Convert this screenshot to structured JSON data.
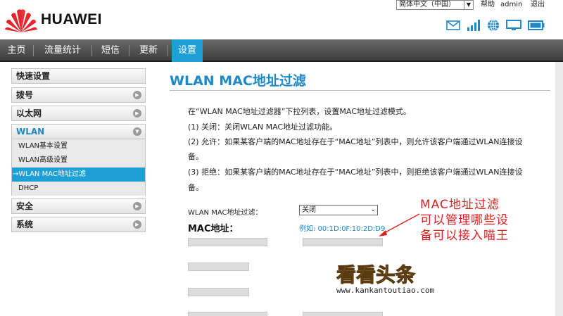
{
  "brand": {
    "name": "HUAWEI",
    "logo_color": "#e5262c"
  },
  "header": {
    "language": "简体中文（中国）",
    "help": "帮助",
    "user": "admin",
    "logout": "退出",
    "status_icons": [
      "mail-icon",
      "signal-icon",
      "globe-icon",
      "monitor-icon",
      "battery-icon"
    ]
  },
  "nav": {
    "items": [
      "主页",
      "流量统计",
      "短信",
      "更新",
      "设置"
    ],
    "active": "设置",
    "active_color": "#1e9fd6"
  },
  "sidebar": {
    "groups": [
      {
        "label": "快速设置"
      },
      {
        "label": "拨号"
      },
      {
        "label": "以太网"
      },
      {
        "label": "WLAN",
        "expanded": true,
        "items": [
          "WLAN基本设置",
          "WLAN高级设置",
          "→WLAN MAC地址过滤",
          "DHCP"
        ],
        "active_item": "→WLAN MAC地址过滤"
      },
      {
        "label": "安全"
      },
      {
        "label": "系统"
      }
    ]
  },
  "main": {
    "title": "WLAN MAC地址过滤",
    "description": [
      "在“WLAN MAC地址过滤器”下拉列表，设置MAC地址过滤模式。",
      "(1) 关闭：关闭WLAN MAC地址过滤功能。",
      "(2) 允许：如果某客户端的MAC地址存在于“MAC地址”列表中，则允许该客户端通过WLAN连接设",
      "备。",
      "(3) 拒绝：如果某客户端的MAC地址存在于“MAC地址”列表中，则拒绝该客户端通过WLAN连接设",
      "备。"
    ],
    "filter_label": "WLAN MAC地址过滤：",
    "filter_value": "关闭",
    "mac_label": "MAC地址：",
    "example": "例如: 00:1D:0F:10:2D:D9"
  },
  "annotation": {
    "lines": [
      "MAC地址过滤",
      "可以管理哪些设",
      "备可以接入喵王"
    ],
    "color": "#e02020"
  },
  "watermark": {
    "title": "看看头条",
    "url": "www.kankantoutiao.com"
  }
}
